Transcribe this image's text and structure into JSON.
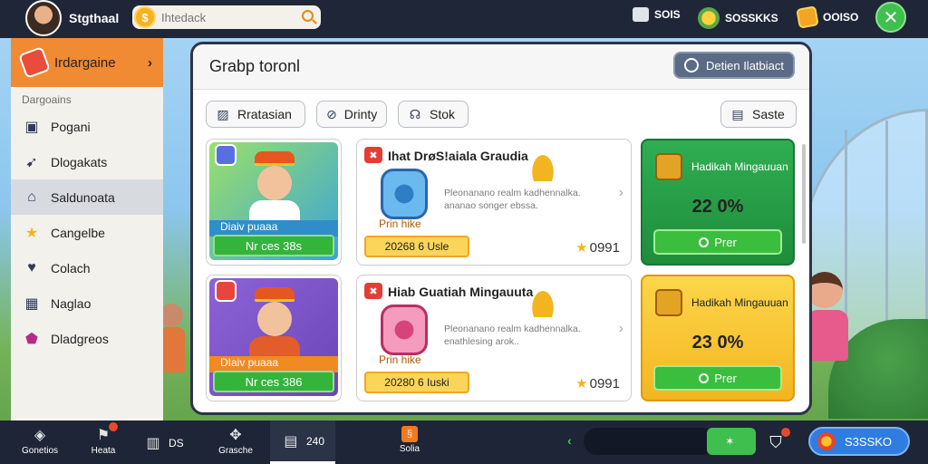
{
  "topbar": {
    "username": "Stgthaal",
    "search_placeholder": "Ihtedack",
    "coin_symbol": "$",
    "stat1": "SOIS",
    "stat2": "SOSSKKS",
    "stat3": "OOISO",
    "close_symbol": "✕"
  },
  "sidebar": {
    "header_label": "Irdargaine",
    "section_label": "Dargoains",
    "items": [
      {
        "label": "Pogani",
        "icon": "briefcase-icon"
      },
      {
        "label": "Dlogakats",
        "icon": "rocket-icon"
      },
      {
        "label": "Saldunoata",
        "icon": "home-icon"
      },
      {
        "label": "Cangelbe",
        "icon": "star-icon"
      },
      {
        "label": "Colach",
        "icon": "heart-icon"
      },
      {
        "label": "Naglao",
        "icon": "calendar-icon"
      },
      {
        "label": "Dladgreos",
        "icon": "gem-icon"
      }
    ]
  },
  "panel": {
    "title": "Grabp toronl",
    "top_action": "Detien Ilatbiact",
    "filters": [
      "Rratasian",
      "Drinty",
      "Stok"
    ],
    "sort_label": "Saste",
    "heroes": [
      {
        "label": "Diaiv puaaa",
        "button": "Nr ces 38s"
      },
      {
        "label": "DIaiv puaaa",
        "button": "Nr ces 386"
      }
    ],
    "offers": [
      {
        "title": "Ihat DrøS!aiala Graudia",
        "desc": "Pleonanano realm kadhennalka. ananao songer ebssa.",
        "sub": "Prin hike",
        "price": "20268 6 Usle",
        "stars": "0991"
      },
      {
        "title": "Hiab Guatiah Mingauuta",
        "desc": "Pleonanano realm kadhennalka. enathlesing arok..",
        "sub": "Prin hike",
        "price": "20280 6 Iuski",
        "stars": "0991"
      }
    ],
    "rewards": [
      {
        "title": "Hadikah Mingauuan",
        "value": "22 0%",
        "button": "Prer",
        "color": "#2fae52"
      },
      {
        "title": "Hadikah Mingauuan",
        "value": "23 0%",
        "button": "Prer",
        "color": "#fcd64a"
      }
    ]
  },
  "bottombar": {
    "items": [
      {
        "label": "Gonetios",
        "icon": "layers-icon"
      },
      {
        "label": "Heata",
        "icon": "flag-icon"
      },
      {
        "label": "DS",
        "icon": "book-icon"
      },
      {
        "label": "Grasche",
        "icon": "cluster-icon"
      },
      {
        "label": "240",
        "icon": "document-icon"
      },
      {
        "label": "Solia",
        "icon": "rune-icon"
      }
    ],
    "green_pill": "",
    "search_button": "S3SSKO"
  }
}
